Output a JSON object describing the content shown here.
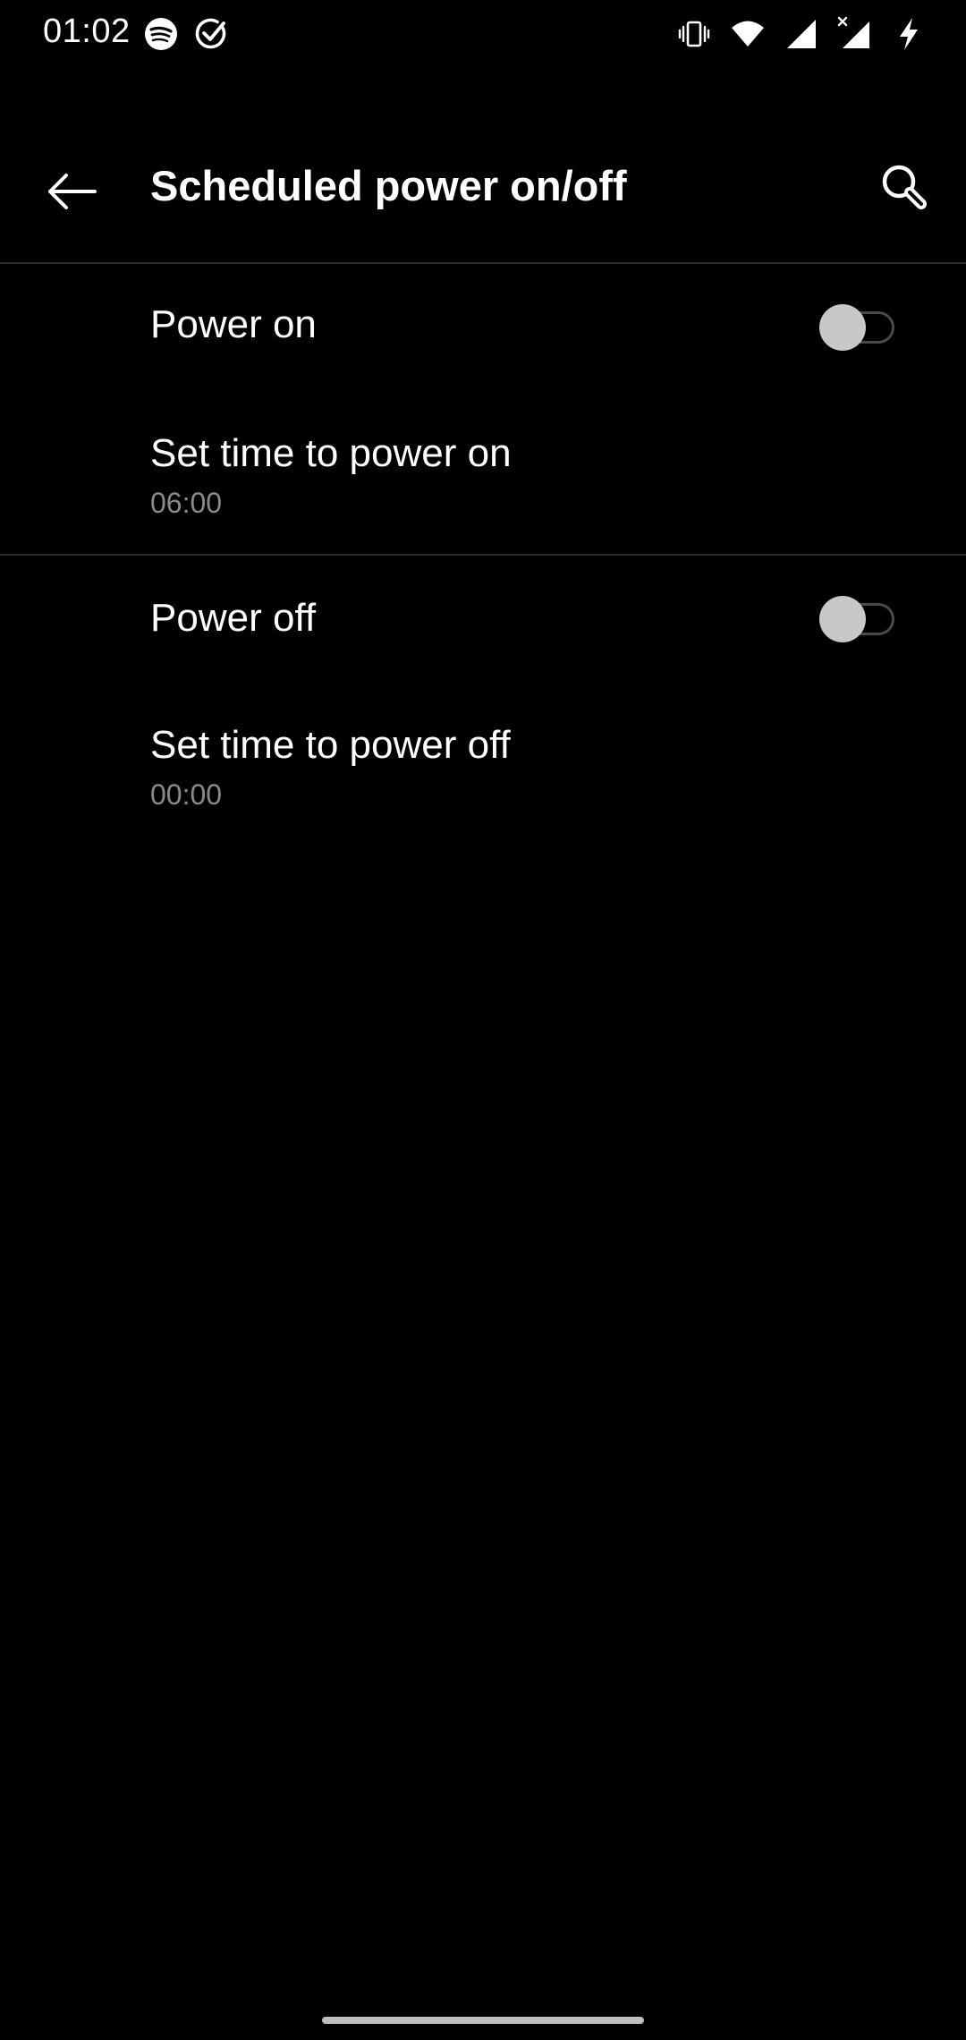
{
  "status_bar": {
    "time": "01:02",
    "left_icons": [
      "spotify-icon",
      "checkmark-circle-icon"
    ],
    "right_icons": [
      "vibrate-icon",
      "wifi-icon",
      "signal-icon",
      "signal-no-data-icon",
      "charging-icon"
    ]
  },
  "header": {
    "title": "Scheduled power on/off",
    "back_icon": "back-arrow-icon",
    "search_icon": "search-icon"
  },
  "settings": {
    "power_on": {
      "label": "Power on",
      "enabled": false
    },
    "power_on_time": {
      "label": "Set time to power on",
      "value": "06:00"
    },
    "power_off": {
      "label": "Power off",
      "enabled": false
    },
    "power_off_time": {
      "label": "Set time to power off",
      "value": "00:00"
    }
  },
  "colors": {
    "background": "#000000",
    "text_primary": "#ffffff",
    "text_secondary": "#8a8a8a",
    "divider": "#2a2a2a",
    "toggle_thumb_off": "#c8c8c8",
    "toggle_track_off": "#4a4a4a"
  }
}
